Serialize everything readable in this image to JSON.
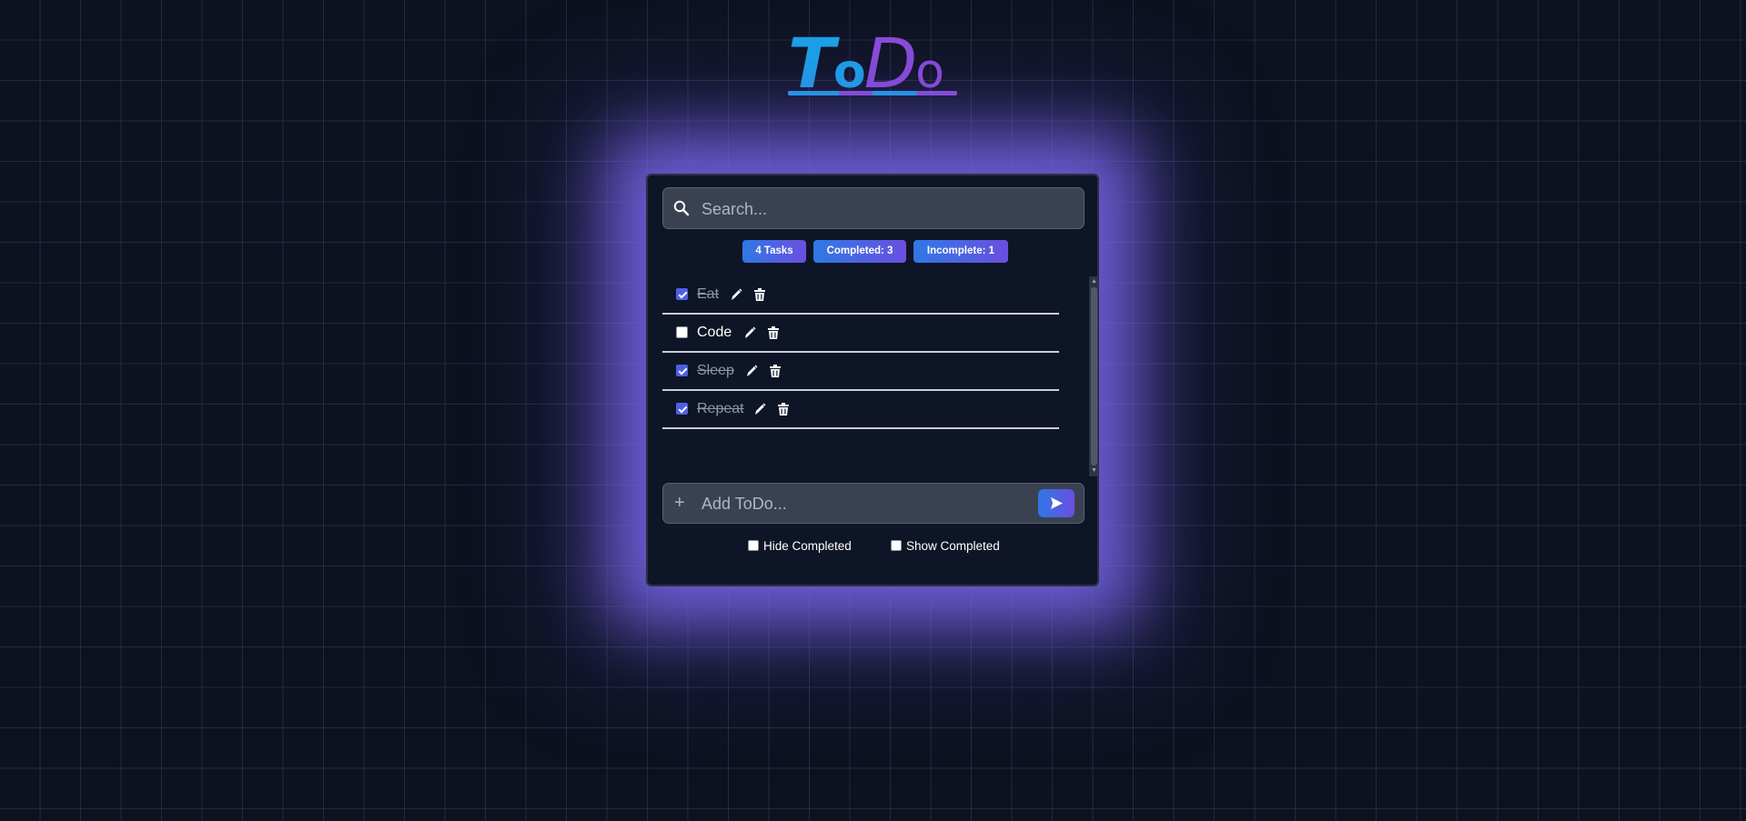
{
  "logo": {
    "t": "T",
    "o1": "o",
    "d": "D",
    "o2": "o"
  },
  "search": {
    "placeholder": "Search..."
  },
  "stats": {
    "total": "4 Tasks",
    "completed": "Completed: 3",
    "incomplete": "Incomplete: 1"
  },
  "todos": [
    {
      "text": "Eat",
      "done": true
    },
    {
      "text": "Code",
      "done": false
    },
    {
      "text": "Sleep",
      "done": true
    },
    {
      "text": "Repeat",
      "done": true
    }
  ],
  "add": {
    "placeholder": "Add ToDo...",
    "plus": "+"
  },
  "filters": {
    "hide_completed": "Hide Completed",
    "show_completed": "Show Completed"
  },
  "colors": {
    "accent_blue": "#1aa3e8",
    "accent_purple": "#8a4bd9",
    "checkbox": "#4f5ee8"
  },
  "icons": {
    "search": "search-icon",
    "edit": "pencil-icon",
    "delete": "trash-icon",
    "send": "send-icon",
    "add": "plus-icon"
  }
}
